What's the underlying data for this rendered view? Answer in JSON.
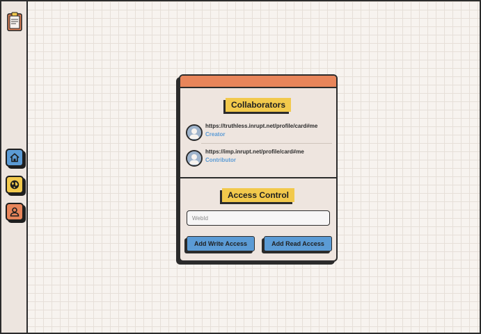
{
  "sidebar": {
    "items": [
      {
        "name": "clipboard-icon",
        "color": "#e8855a"
      },
      {
        "name": "home-icon",
        "color": "#5b9bd5"
      },
      {
        "name": "globe-icon",
        "color": "#f2c94c"
      },
      {
        "name": "user-icon",
        "color": "#e8855a"
      }
    ]
  },
  "card": {
    "collaborators_title": "Collaborators",
    "collaborators": [
      {
        "webid": "https://truthless.inrupt.net/profile/card#me",
        "role": "Creator"
      },
      {
        "webid": "https://imp.inrupt.net/profile/card#me",
        "role": "Contributor"
      }
    ],
    "access_title": "Access Control",
    "webid_placeholder": "WebId",
    "add_write_label": "Add Write Access",
    "add_read_label": "Add Read Access"
  },
  "colors": {
    "accent_orange": "#e8855a",
    "accent_yellow": "#f2c94c",
    "accent_blue": "#5b9bd5"
  }
}
